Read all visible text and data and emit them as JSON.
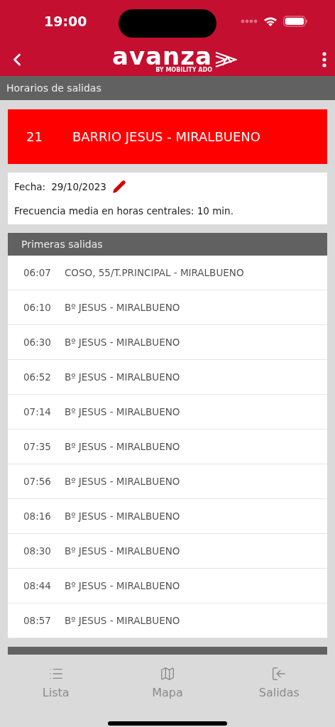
{
  "status_bar": {
    "time": "19:00"
  },
  "header": {
    "logo": "avanza",
    "logo_sub_by": "BY",
    "logo_sub_brand": "MOBILITY",
    "logo_sub_ado": "ADO"
  },
  "subheader": {
    "title": "Horarios de salidas"
  },
  "route": {
    "number": "21",
    "name": "BARRIO JESUS - MIRALBUENO"
  },
  "info": {
    "date_label": "Fecha:",
    "date": "29/10/2023",
    "frequency": "Frecuencia media en horas centrales: 10 min."
  },
  "sections": [
    {
      "title": "Primeras salidas",
      "rows": [
        {
          "time": "06:07",
          "destination": "COSO, 55/T.PRINCIPAL - MIRALBUENO"
        },
        {
          "time": "06:10",
          "destination": "Bº JESUS - MIRALBUENO"
        },
        {
          "time": "06:30",
          "destination": "Bº JESUS - MIRALBUENO"
        },
        {
          "time": "06:52",
          "destination": "Bº JESUS - MIRALBUENO"
        },
        {
          "time": "07:14",
          "destination": "Bº JESUS - MIRALBUENO"
        },
        {
          "time": "07:35",
          "destination": "Bº JESUS - MIRALBUENO"
        },
        {
          "time": "07:56",
          "destination": "Bº JESUS - MIRALBUENO"
        },
        {
          "time": "08:16",
          "destination": "Bº JESUS - MIRALBUENO"
        },
        {
          "time": "08:30",
          "destination": "Bº JESUS - MIRALBUENO"
        },
        {
          "time": "08:44",
          "destination": "Bº JESUS - MIRALBUENO"
        },
        {
          "time": "08:57",
          "destination": "Bº JESUS - MIRALBUENO"
        }
      ]
    }
  ],
  "tab_bar": [
    {
      "kind": "list",
      "label": "Lista"
    },
    {
      "kind": "map",
      "label": "Mapa"
    },
    {
      "kind": "exit",
      "label": "Salidas"
    }
  ]
}
